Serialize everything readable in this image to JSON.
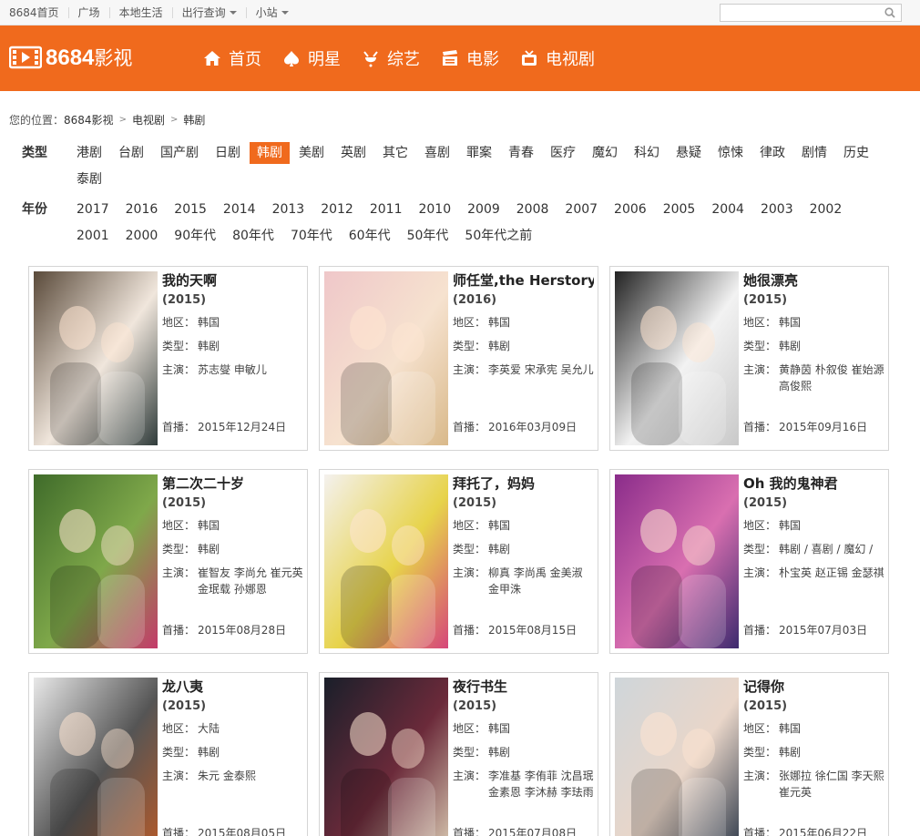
{
  "topbar": {
    "links": [
      {
        "label": "8684首页",
        "dropdown": false
      },
      {
        "label": "广场",
        "dropdown": false
      },
      {
        "label": "本地生活",
        "dropdown": false
      },
      {
        "label": "出行查询",
        "dropdown": true
      },
      {
        "label": "小站",
        "dropdown": true
      }
    ],
    "search_value": ""
  },
  "header": {
    "brand_num": "8684",
    "brand_suffix": "影视",
    "nav": [
      "首页",
      "明星",
      "综艺",
      "电影",
      "电视剧"
    ]
  },
  "breadcrumb": {
    "prefix": "您的位置：",
    "items": [
      "8684影视",
      "电视剧",
      "韩剧"
    ]
  },
  "filters": {
    "type_label": "类型",
    "types": [
      "港剧",
      "台剧",
      "国产剧",
      "日剧",
      "韩剧",
      "美剧",
      "英剧",
      "其它",
      "喜剧",
      "罪案",
      "青春",
      "医疗",
      "魔幻",
      "科幻",
      "悬疑",
      "惊悚",
      "律政",
      "剧情",
      "历史",
      "泰剧"
    ],
    "type_active": "韩剧",
    "year_label": "年份",
    "years": [
      "2017",
      "2016",
      "2015",
      "2014",
      "2013",
      "2012",
      "2011",
      "2010",
      "2009",
      "2008",
      "2007",
      "2006",
      "2005",
      "2004",
      "2003",
      "2002",
      "2001",
      "2000",
      "90年代",
      "80年代",
      "70年代",
      "60年代",
      "50年代",
      "50年代之前"
    ]
  },
  "labels": {
    "region": "地区：",
    "genre": "类型：",
    "cast": "主演：",
    "premiere": "首播："
  },
  "shows": [
    {
      "title": "我的天啊",
      "year": "(2015)",
      "region": "韩国",
      "genre": "韩剧",
      "cast": "苏志燮  申敏儿",
      "premiere": "2015年12月24日",
      "palette": [
        "#5a4a3a",
        "#f0e6dc",
        "#2f3b3a"
      ]
    },
    {
      "title": "师任堂,the Herstory",
      "year": "(2016)",
      "region": "韩国",
      "genre": "韩剧",
      "cast": "李英爱  宋承宪  吴允儿",
      "premiere": "2016年03月09日",
      "palette": [
        "#efc7c9",
        "#f6e2cf",
        "#d9b98a"
      ]
    },
    {
      "title": "她很漂亮",
      "year": "(2015)",
      "region": "韩国",
      "genre": "韩剧",
      "cast": "黄静茵  朴叙俊  崔始源  高俊熙",
      "premiere": "2015年09月16日",
      "palette": [
        "#222222",
        "#f2f2f2",
        "#c9c9c9"
      ]
    },
    {
      "title": "第二次二十岁",
      "year": "(2015)",
      "region": "韩国",
      "genre": "韩剧",
      "cast": "崔智友  李尚允  崔元英  金珉载  孙娜恩",
      "premiere": "2015年08月28日",
      "palette": [
        "#3f6b2a",
        "#7fa84a",
        "#c43a6a"
      ]
    },
    {
      "title": "拜托了，妈妈",
      "year": "(2015)",
      "region": "韩国",
      "genre": "韩剧",
      "cast": "柳真  李尚禹  金美淑  金甲洙",
      "premiere": "2015年08月15日",
      "palette": [
        "#f4f1ee",
        "#e7d34a",
        "#d6467a"
      ]
    },
    {
      "title": "Oh 我的鬼神君",
      "year": "(2015)",
      "region": "韩国",
      "genre": "韩剧 / 喜剧 / 魔幻 /",
      "cast": "朴宝英  赵正锡  金瑟祺",
      "premiere": "2015年07月03日",
      "palette": [
        "#8a2c8a",
        "#d96fb0",
        "#3d2a6e"
      ]
    },
    {
      "title": "龙八夷",
      "year": "(2015)",
      "region": "大陆",
      "genre": "韩剧",
      "cast": "朱元  金泰熙",
      "premiere": "2015年08月05日",
      "palette": [
        "#e8e8e8",
        "#555555",
        "#b45a2a"
      ]
    },
    {
      "title": "夜行书生",
      "year": "(2015)",
      "region": "韩国",
      "genre": "韩剧",
      "cast": "李准基  李侑菲  沈昌珉  金素恩  李沐赫  李珐雨",
      "premiere": "2015年07月08日",
      "palette": [
        "#1a1f2a",
        "#6b2a3a",
        "#d7c7b0"
      ]
    },
    {
      "title": "记得你",
      "year": "(2015)",
      "region": "韩国",
      "genre": "韩剧",
      "cast": "张娜拉  徐仁国  李天熙  崔元英",
      "premiere": "2015年06月22日",
      "palette": [
        "#cfd6da",
        "#e9d6c9",
        "#2f3a4a"
      ]
    }
  ]
}
